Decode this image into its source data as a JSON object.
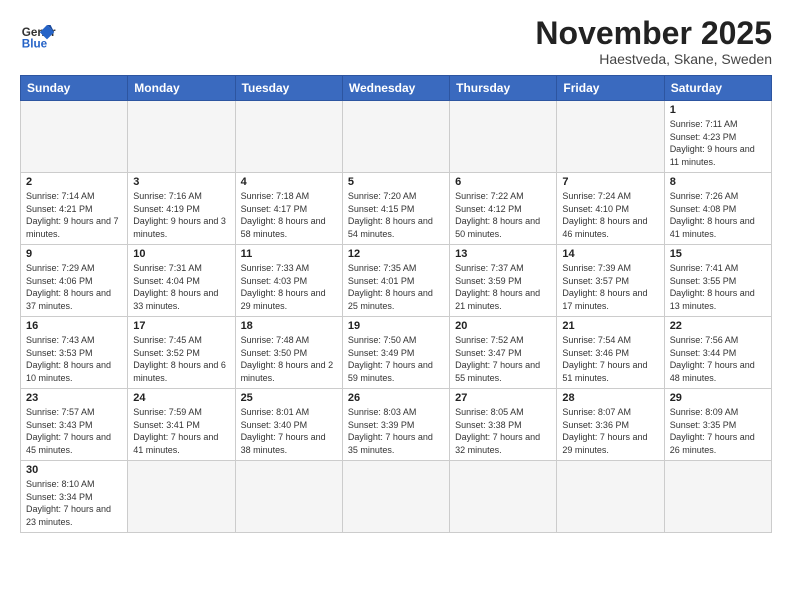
{
  "header": {
    "logo_general": "General",
    "logo_blue": "Blue",
    "month_title": "November 2025",
    "subtitle": "Haestveda, Skane, Sweden"
  },
  "days_of_week": [
    "Sunday",
    "Monday",
    "Tuesday",
    "Wednesday",
    "Thursday",
    "Friday",
    "Saturday"
  ],
  "weeks": [
    [
      {
        "num": "",
        "info": "",
        "empty": true
      },
      {
        "num": "",
        "info": "",
        "empty": true
      },
      {
        "num": "",
        "info": "",
        "empty": true
      },
      {
        "num": "",
        "info": "",
        "empty": true
      },
      {
        "num": "",
        "info": "",
        "empty": true
      },
      {
        "num": "",
        "info": "",
        "empty": true
      },
      {
        "num": "1",
        "info": "Sunrise: 7:11 AM\nSunset: 4:23 PM\nDaylight: 9 hours\nand 11 minutes.",
        "empty": false
      }
    ],
    [
      {
        "num": "2",
        "info": "Sunrise: 7:14 AM\nSunset: 4:21 PM\nDaylight: 9 hours\nand 7 minutes.",
        "empty": false
      },
      {
        "num": "3",
        "info": "Sunrise: 7:16 AM\nSunset: 4:19 PM\nDaylight: 9 hours\nand 3 minutes.",
        "empty": false
      },
      {
        "num": "4",
        "info": "Sunrise: 7:18 AM\nSunset: 4:17 PM\nDaylight: 8 hours\nand 58 minutes.",
        "empty": false
      },
      {
        "num": "5",
        "info": "Sunrise: 7:20 AM\nSunset: 4:15 PM\nDaylight: 8 hours\nand 54 minutes.",
        "empty": false
      },
      {
        "num": "6",
        "info": "Sunrise: 7:22 AM\nSunset: 4:12 PM\nDaylight: 8 hours\nand 50 minutes.",
        "empty": false
      },
      {
        "num": "7",
        "info": "Sunrise: 7:24 AM\nSunset: 4:10 PM\nDaylight: 8 hours\nand 46 minutes.",
        "empty": false
      },
      {
        "num": "8",
        "info": "Sunrise: 7:26 AM\nSunset: 4:08 PM\nDaylight: 8 hours\nand 41 minutes.",
        "empty": false
      }
    ],
    [
      {
        "num": "9",
        "info": "Sunrise: 7:29 AM\nSunset: 4:06 PM\nDaylight: 8 hours\nand 37 minutes.",
        "empty": false
      },
      {
        "num": "10",
        "info": "Sunrise: 7:31 AM\nSunset: 4:04 PM\nDaylight: 8 hours\nand 33 minutes.",
        "empty": false
      },
      {
        "num": "11",
        "info": "Sunrise: 7:33 AM\nSunset: 4:03 PM\nDaylight: 8 hours\nand 29 minutes.",
        "empty": false
      },
      {
        "num": "12",
        "info": "Sunrise: 7:35 AM\nSunset: 4:01 PM\nDaylight: 8 hours\nand 25 minutes.",
        "empty": false
      },
      {
        "num": "13",
        "info": "Sunrise: 7:37 AM\nSunset: 3:59 PM\nDaylight: 8 hours\nand 21 minutes.",
        "empty": false
      },
      {
        "num": "14",
        "info": "Sunrise: 7:39 AM\nSunset: 3:57 PM\nDaylight: 8 hours\nand 17 minutes.",
        "empty": false
      },
      {
        "num": "15",
        "info": "Sunrise: 7:41 AM\nSunset: 3:55 PM\nDaylight: 8 hours\nand 13 minutes.",
        "empty": false
      }
    ],
    [
      {
        "num": "16",
        "info": "Sunrise: 7:43 AM\nSunset: 3:53 PM\nDaylight: 8 hours\nand 10 minutes.",
        "empty": false
      },
      {
        "num": "17",
        "info": "Sunrise: 7:45 AM\nSunset: 3:52 PM\nDaylight: 8 hours\nand 6 minutes.",
        "empty": false
      },
      {
        "num": "18",
        "info": "Sunrise: 7:48 AM\nSunset: 3:50 PM\nDaylight: 8 hours\nand 2 minutes.",
        "empty": false
      },
      {
        "num": "19",
        "info": "Sunrise: 7:50 AM\nSunset: 3:49 PM\nDaylight: 7 hours\nand 59 minutes.",
        "empty": false
      },
      {
        "num": "20",
        "info": "Sunrise: 7:52 AM\nSunset: 3:47 PM\nDaylight: 7 hours\nand 55 minutes.",
        "empty": false
      },
      {
        "num": "21",
        "info": "Sunrise: 7:54 AM\nSunset: 3:46 PM\nDaylight: 7 hours\nand 51 minutes.",
        "empty": false
      },
      {
        "num": "22",
        "info": "Sunrise: 7:56 AM\nSunset: 3:44 PM\nDaylight: 7 hours\nand 48 minutes.",
        "empty": false
      }
    ],
    [
      {
        "num": "23",
        "info": "Sunrise: 7:57 AM\nSunset: 3:43 PM\nDaylight: 7 hours\nand 45 minutes.",
        "empty": false
      },
      {
        "num": "24",
        "info": "Sunrise: 7:59 AM\nSunset: 3:41 PM\nDaylight: 7 hours\nand 41 minutes.",
        "empty": false
      },
      {
        "num": "25",
        "info": "Sunrise: 8:01 AM\nSunset: 3:40 PM\nDaylight: 7 hours\nand 38 minutes.",
        "empty": false
      },
      {
        "num": "26",
        "info": "Sunrise: 8:03 AM\nSunset: 3:39 PM\nDaylight: 7 hours\nand 35 minutes.",
        "empty": false
      },
      {
        "num": "27",
        "info": "Sunrise: 8:05 AM\nSunset: 3:38 PM\nDaylight: 7 hours\nand 32 minutes.",
        "empty": false
      },
      {
        "num": "28",
        "info": "Sunrise: 8:07 AM\nSunset: 3:36 PM\nDaylight: 7 hours\nand 29 minutes.",
        "empty": false
      },
      {
        "num": "29",
        "info": "Sunrise: 8:09 AM\nSunset: 3:35 PM\nDaylight: 7 hours\nand 26 minutes.",
        "empty": false
      }
    ],
    [
      {
        "num": "30",
        "info": "Sunrise: 8:10 AM\nSunset: 3:34 PM\nDaylight: 7 hours\nand 23 minutes.",
        "empty": false
      },
      {
        "num": "",
        "info": "",
        "empty": true
      },
      {
        "num": "",
        "info": "",
        "empty": true
      },
      {
        "num": "",
        "info": "",
        "empty": true
      },
      {
        "num": "",
        "info": "",
        "empty": true
      },
      {
        "num": "",
        "info": "",
        "empty": true
      },
      {
        "num": "",
        "info": "",
        "empty": true
      }
    ]
  ]
}
